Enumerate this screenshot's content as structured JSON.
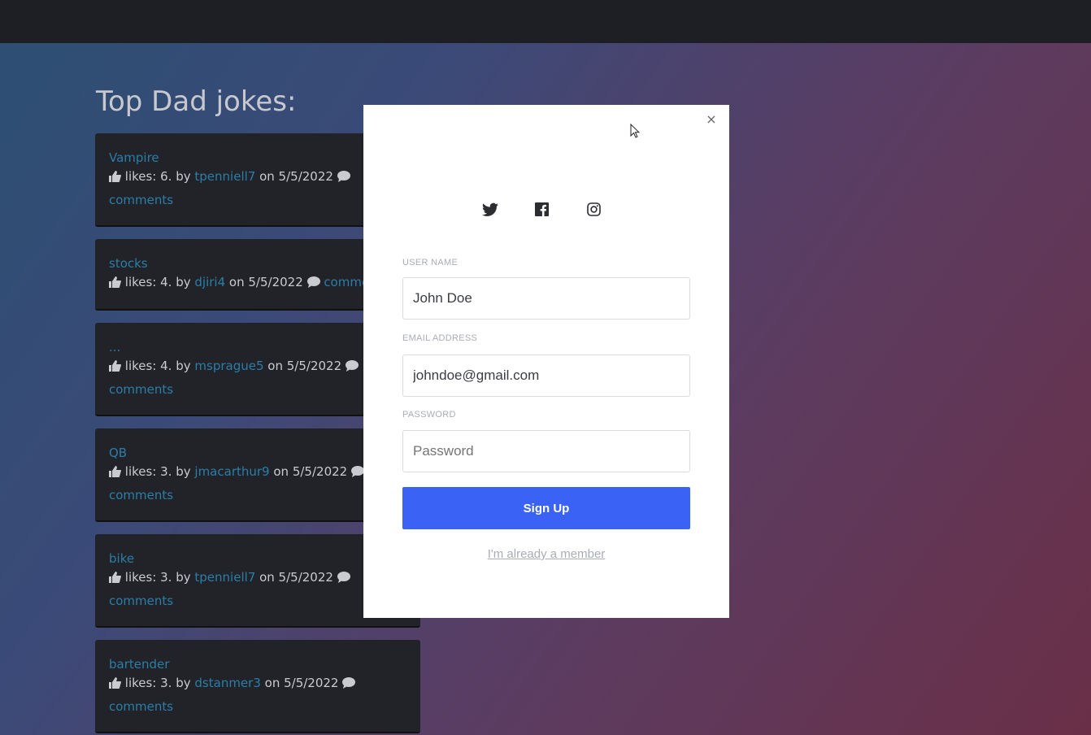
{
  "page": {
    "title": "Top Dad jokes:"
  },
  "jokes": [
    {
      "title": "Vampire",
      "likes_text": "likes: 6. by",
      "user": "tpenniell7",
      "date_text": "on 5/5/2022",
      "comments": "comments"
    },
    {
      "title": "stocks",
      "likes_text": "likes: 4. by",
      "user": "djiri4",
      "date_text": "on 5/5/2022",
      "comments": "comments"
    },
    {
      "title": "...",
      "likes_text": "likes: 4. by",
      "user": "msprague5",
      "date_text": "on 5/5/2022",
      "comments": "comments"
    },
    {
      "title": "QB",
      "likes_text": "likes: 3. by",
      "user": "jmacarthur9",
      "date_text": "on 5/5/2022",
      "comments": "comments"
    },
    {
      "title": "bike",
      "likes_text": "likes: 3. by",
      "user": "tpenniell7",
      "date_text": "on 5/5/2022",
      "comments": "comments"
    },
    {
      "title": "bartender",
      "likes_text": "likes: 3. by",
      "user": "dstanmer3",
      "date_text": "on 5/5/2022",
      "comments": "comments"
    }
  ],
  "modal": {
    "close": "×",
    "social": [
      "twitter-icon",
      "facebook-icon",
      "instagram-icon"
    ],
    "username": {
      "label": "USER NAME",
      "value": "John Doe"
    },
    "email": {
      "label": "EMAIL ADDRESS",
      "value": "johndoe@gmail.com"
    },
    "password": {
      "label": "PASSWORD",
      "placeholder": "Password"
    },
    "signup_label": "Sign Up",
    "member_link": "I'm already a member"
  },
  "colors": {
    "accent": "#3a63f5",
    "link": "#2a7ea8",
    "card": "#222328",
    "nav": "#1e1f24"
  }
}
